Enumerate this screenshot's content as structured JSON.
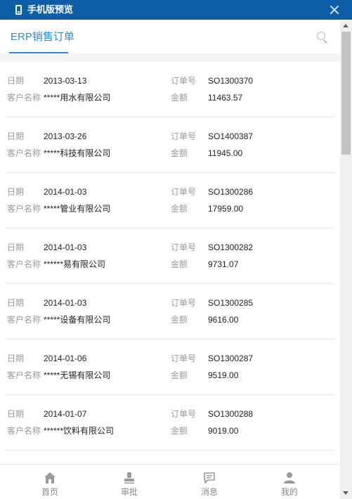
{
  "window": {
    "title": "手机版预览",
    "phone_icon": "mobile-phone-icon",
    "close_icon": "close-icon"
  },
  "header": {
    "title": "ERP销售订单",
    "accent_color": "#2d8ad6",
    "search_icon": "search-icon"
  },
  "labels": {
    "date": "日期",
    "order_no": "订单号",
    "customer": "客户名称",
    "amount": "金额"
  },
  "orders": [
    {
      "date": "2013-03-13",
      "order_no": "SO1300370",
      "customer": "*****用水有限公司",
      "amount": "11463.57"
    },
    {
      "date": "2013-03-26",
      "order_no": "SO1400387",
      "customer": "*****科技有限公司",
      "amount": "11945.00"
    },
    {
      "date": "2014-01-03",
      "order_no": "SO1300286",
      "customer": "*****管业有限公司",
      "amount": "17959.00"
    },
    {
      "date": "2014-01-03",
      "order_no": "SO1300282",
      "customer": "******易有限公司",
      "amount": "9731.07"
    },
    {
      "date": "2014-01-03",
      "order_no": "SO1300285",
      "customer": "*****设备有限公司",
      "amount": "9616.00"
    },
    {
      "date": "2014-01-06",
      "order_no": "SO1300287",
      "customer": "*****无锡有限公司",
      "amount": "9519.00"
    },
    {
      "date": "2014-01-07",
      "order_no": "SO1300288",
      "customer": "******饮料有限公司",
      "amount": "9019.00"
    }
  ],
  "bottom_nav": [
    {
      "label": "首页",
      "icon": "home-icon"
    },
    {
      "label": "审批",
      "icon": "approval-stamp-icon"
    },
    {
      "label": "消息",
      "icon": "message-icon"
    },
    {
      "label": "我的",
      "icon": "user-icon"
    }
  ],
  "colors": {
    "titlebar": "#0d5ea8",
    "label_gray": "#9a9a9a",
    "nav_gray": "#8a8a8a"
  }
}
